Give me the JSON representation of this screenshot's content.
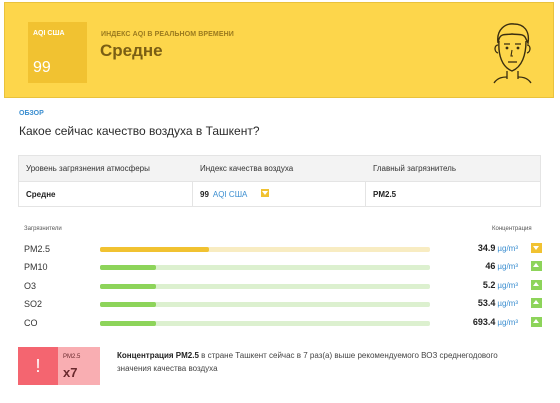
{
  "header": {
    "aqi_label": "AQI США",
    "aqi_value": "99",
    "realtime_label": "ИНДЕКС AQI В РЕАЛЬНОМ ВРЕМЕНИ",
    "level": "Средне",
    "background_color": "#fdd64b",
    "icon": "face-icon"
  },
  "overview": {
    "label": "ОБЗОР",
    "question": "Какое сейчас качество воздуха в Ташкент?"
  },
  "table": {
    "headers": [
      "Уровень загрязнения атмосферы",
      "Индекс качества воздуха",
      "Главный загрязнитель"
    ],
    "level": "Средне",
    "aqi_value": "99",
    "aqi_unit": "AQI США",
    "main_pollutant": "PM2.5"
  },
  "pollutants": {
    "header_left": "Загрязнители",
    "header_right": "Концентрация",
    "unit": "µg/m³",
    "items": [
      {
        "name": "PM2.5",
        "value": "34.9",
        "level_fraction": 0.33,
        "trend": "down",
        "color": "#f1c231",
        "track": "#f8ecc2"
      },
      {
        "name": "PM10",
        "value": "46",
        "level_fraction": 0.17,
        "trend": "up",
        "color": "#8dd45a",
        "track": "#dcf0cf"
      },
      {
        "name": "O3",
        "value": "5.2",
        "level_fraction": 0.17,
        "trend": "up",
        "color": "#8dd45a",
        "track": "#dcf0cf"
      },
      {
        "name": "SO2",
        "value": "53.4",
        "level_fraction": 0.17,
        "trend": "up",
        "color": "#8dd45a",
        "track": "#dcf0cf"
      },
      {
        "name": "CO",
        "value": "693.4",
        "level_fraction": 0.17,
        "trend": "up",
        "color": "#8dd45a",
        "track": "#dcf0cf"
      }
    ]
  },
  "alert": {
    "icon_glyph": "!",
    "pollutant": "PM2.5",
    "multiplier": "x7",
    "text_bold": "Концентрация PM2.5",
    "text_rest": " в стране Ташкент сейчас в 7 раз(а) выше рекомендуемого ВОЗ среднегодового значения качества воздуха"
  }
}
